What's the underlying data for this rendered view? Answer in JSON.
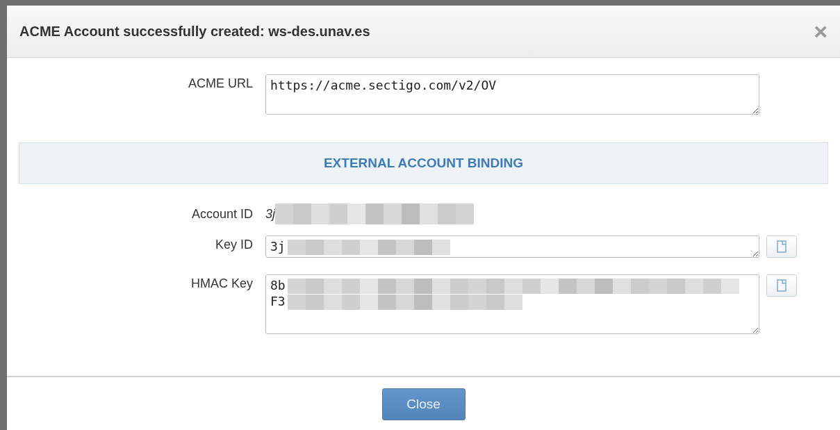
{
  "dialog": {
    "title": "ACME Account successfully created: ws-des.unav.es",
    "close_glyph": "×"
  },
  "fields": [
    {
      "kind": "textarea",
      "label": "ACME URL",
      "value": "https://acme.sectigo.com/v2/OV",
      "copy": false,
      "redacted": false
    },
    {
      "kind": "section",
      "label": "EXTERNAL ACCOUNT BINDING"
    },
    {
      "kind": "text",
      "label": "Account ID",
      "value": "3j",
      "redacted": true
    },
    {
      "kind": "textarea",
      "label": "Key ID",
      "value": "3j",
      "copy": true,
      "redacted": true
    },
    {
      "kind": "textarea",
      "label": "HMAC Key",
      "value": "8b\nF3",
      "copy": true,
      "redacted": true
    }
  ],
  "buttons": [
    {
      "label": "Close"
    }
  ]
}
